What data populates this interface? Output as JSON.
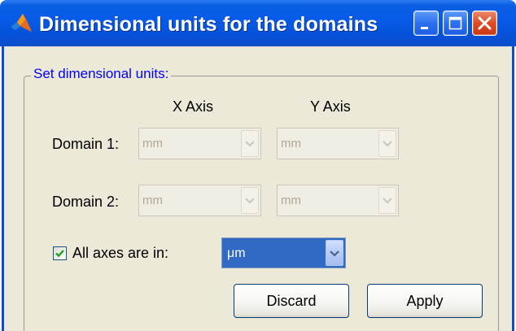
{
  "window": {
    "title": "Dimensional units for the domains"
  },
  "group": {
    "label": "Set dimensional units:"
  },
  "columns": {
    "x_axis": "X Axis",
    "y_axis": "Y Axis"
  },
  "domains": [
    {
      "label": "Domain 1:",
      "x_unit": "mm",
      "y_unit": "mm",
      "enabled": false
    },
    {
      "label": "Domain 2:",
      "x_unit": "mm",
      "y_unit": "mm",
      "enabled": false
    }
  ],
  "all_axes": {
    "checked": true,
    "label": "All axes are in:",
    "unit": "μm"
  },
  "buttons": {
    "discard": "Discard",
    "apply": "Apply"
  },
  "colors": {
    "titlebar": "#0a5ee0",
    "dialog_bg": "#ece9d8",
    "group_label": "#0000ff",
    "selected_combo": "#316ac5",
    "close_button": "#de4b25"
  },
  "icons": {
    "title": "matlab-logo-icon",
    "minimize": "minimize-icon",
    "maximize": "maximize-icon",
    "close": "close-icon",
    "dropdown": "chevron-down-icon",
    "checkbox": "checkmark-icon"
  }
}
